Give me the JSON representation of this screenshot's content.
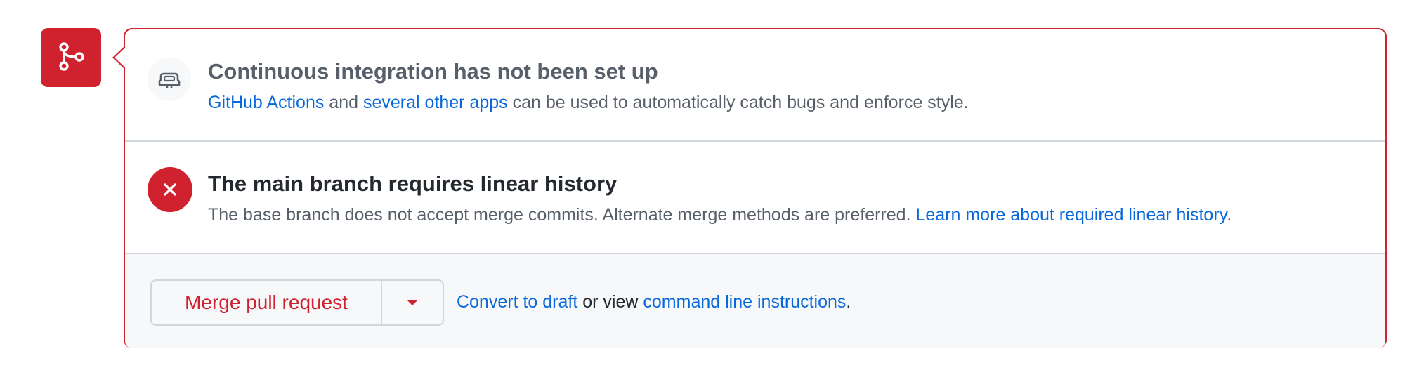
{
  "merge_badge": {
    "icon": "git-merge-icon",
    "color": "#cf222e"
  },
  "ci_section": {
    "icon": "robot-icon",
    "title": "Continuous integration has not been set up",
    "link_actions": "GitHub Actions",
    "text_and": " and ",
    "link_apps": "several other apps",
    "text_rest": " can be used to automatically catch bugs and enforce style."
  },
  "branch_section": {
    "icon": "x-icon",
    "title": "The main branch requires linear history",
    "text": "The base branch does not accept merge commits. Alternate merge methods are preferred. ",
    "link": "Learn more about required linear history",
    "text_end": "."
  },
  "merge_section": {
    "merge_button": "Merge pull request",
    "dropdown_icon": "triangle-down-icon",
    "link_draft": "Convert to draft",
    "text_or": " or view ",
    "link_cli": "command line instructions",
    "text_end": "."
  },
  "colors": {
    "danger": "#cf222e",
    "link": "#0969da",
    "muted": "#57606a",
    "border": "#d0d7de"
  }
}
